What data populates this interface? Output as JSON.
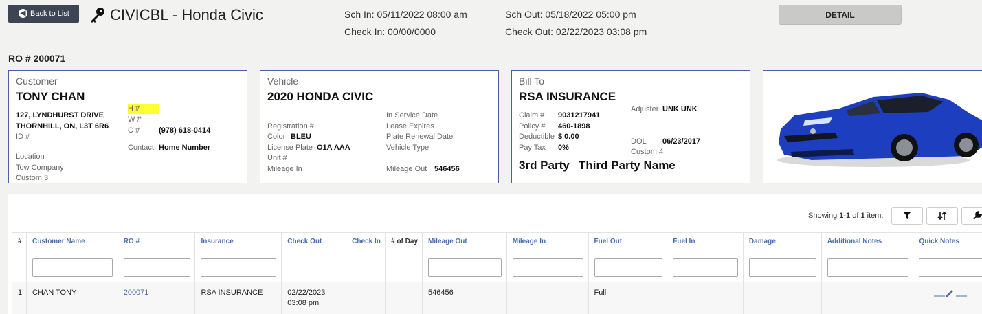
{
  "header": {
    "back_label": "Back to List",
    "title": "CIVICBL - Honda Civic",
    "sch_in": "Sch In: 05/11/2022 08:00 am",
    "check_in": "Check In: 00/00/0000",
    "sch_out": "Sch Out: 05/18/2022 05:00 pm",
    "check_out": "Check Out: 02/22/2023 03:08 pm",
    "detail_label": "DETAIL"
  },
  "ro_label": "RO # 200071",
  "customer": {
    "heading": "Customer",
    "name": "TONY CHAN",
    "address1": "127, LYNDHURST DRIVE",
    "address2": "THORNHILL, ON, L3T 6R6",
    "id_label": "ID #",
    "h_label": "H #",
    "w_label": "W #",
    "c_label": "C #",
    "c_value": "(978) 618-0414",
    "contact_label": "Contact",
    "contact_value": "Home Number",
    "location_label": "Location",
    "tow_label": "Tow Company",
    "custom3_label": "Custom 3"
  },
  "vehicle": {
    "heading": "Vehicle",
    "name": "2020 HONDA CIVIC",
    "registration_label": "Registration #",
    "color_label": "Color",
    "color_value": "BLEU",
    "plate_label": "License Plate",
    "plate_value": "O1A AAA",
    "unit_label": "Unit #",
    "mileage_in_label": "Mileage In",
    "in_service_label": "In Service Date",
    "lease_label": "Lease Expires",
    "plate_renewal_label": "Plate Renewal Date",
    "vehicle_type_label": "Vehicle Type",
    "mileage_out_label": "Mileage Out",
    "mileage_out_value": "546456"
  },
  "bill_to": {
    "heading": "Bill To",
    "name": "RSA INSURANCE",
    "claim_label": "Claim #",
    "claim_value": "9031217941",
    "policy_label": "Policy #",
    "policy_value": "460-1898",
    "deductible_label": "Deductible",
    "deductible_value": "$ 0.00",
    "pay_tax_label": "Pay Tax",
    "pay_tax_value": "0%",
    "adjuster_label": "Adjuster",
    "adjuster_value": "UNK UNK",
    "dol_label": "DOL",
    "dol_value": "06/23/2017",
    "custom4_label": "Custom 4",
    "third_party_label": "3rd Party",
    "third_party_value": "Third Party Name"
  },
  "grid": {
    "showing_prefix": "Showing ",
    "showing_range": "1-1",
    "showing_mid": " of ",
    "showing_total": "1",
    "showing_suffix": " item.",
    "columns": [
      "#",
      "Customer Name",
      "RO #",
      "Insurance",
      "Check Out",
      "Check In",
      "# of Day",
      "Mileage Out",
      "Mileage In",
      "Fuel Out",
      "Fuel In",
      "Damage",
      "Additional Notes",
      "Quick Notes"
    ],
    "row": {
      "num": "1",
      "customer": "CHAN TONY",
      "ro": "200071",
      "insurance": "RSA INSURANCE",
      "check_out_date": "02/22/2023",
      "check_out_time": "03:08 pm",
      "check_in": "",
      "days": "",
      "mileage_out": "546456",
      "mileage_in": "",
      "fuel_out": "Full",
      "fuel_in": "",
      "damage": "",
      "additional_notes": ""
    }
  },
  "colors": {
    "card_border": "#4a5fa8",
    "link": "#4a6fa8",
    "highlight": "#ffff33",
    "car_body": "#1d3fbf"
  },
  "icons": {
    "back": "circle-arrow-left-icon",
    "key": "key-icon",
    "filter": "filter-icon",
    "sort": "sort-arrows-icon",
    "settings": "wrench-icon",
    "edit": "pencil-icon"
  }
}
